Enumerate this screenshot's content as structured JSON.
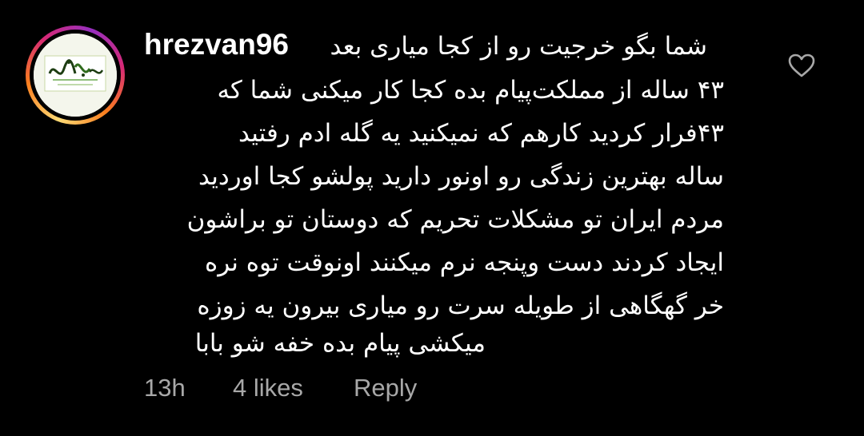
{
  "comment": {
    "username": "hrezvan96",
    "text_lines": [
      "شما بگو خرجیت رو از کجا میاری بعد",
      "۴۳ ساله از مملکت‌پیام بده کجا کار میکنی شما که",
      "۴۳فرار کردید کارهم که نمیکنید یه گله ادم رفتید",
      "ساله بهترین زندگی رو اونور دارید پولشو کجا اوردید",
      "مردم ایران تو مشکلات تحریم که دوستان تو براشون",
      "ایجاد کردند دست وپنجه نرم میکنند اونوقت توه نره",
      "خر گهگاهی از طویله سرت رو میاری بیرون یه زوزه",
      "میکشی پیام بده خفه شو بابا"
    ],
    "timestamp": "13h",
    "likes": "4 likes",
    "reply_label": "Reply",
    "like_icon": "heart-outline-icon",
    "avatar_icon": "calligraphy-avatar-icon"
  },
  "colors": {
    "background": "#000000",
    "text": "#ffffff",
    "meta_text": "#a8a8a8",
    "story_ring": [
      "#feda75",
      "#fa7e1e",
      "#d62976",
      "#962fbf"
    ]
  }
}
